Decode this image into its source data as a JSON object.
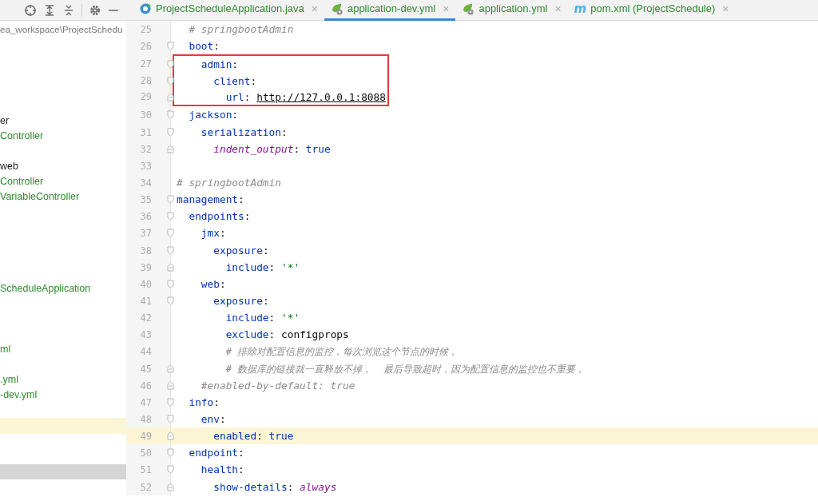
{
  "tabs": [
    {
      "label": "ProjectScheduleApplication.java",
      "kind": "java",
      "close": "×",
      "selected": false
    },
    {
      "label": "application-dev.yml",
      "kind": "spring",
      "close": "×",
      "selected": true
    },
    {
      "label": "application.yml",
      "kind": "spring",
      "close": "×",
      "selected": false
    },
    {
      "label": "pom.xml (ProjectSchedule)",
      "kind": "maven",
      "glyph": "m",
      "close": "×",
      "selected": false
    }
  ],
  "tree": {
    "rows": [
      {
        "kind": "path",
        "text": "ea_workspace\\ProjectSchedu",
        "color": "#787878",
        "selected": false,
        "highlighted": false
      },
      {
        "kind": "blank",
        "selected": false,
        "highlighted": false
      },
      {
        "kind": "blank",
        "selected": false,
        "highlighted": false
      },
      {
        "kind": "blank",
        "selected": false,
        "highlighted": false
      },
      {
        "kind": "blank",
        "selected": false,
        "highlighted": false
      },
      {
        "kind": "blank",
        "selected": false,
        "highlighted": false
      },
      {
        "kind": "node",
        "text": "er",
        "color": "#1f1f1f",
        "selected": false,
        "highlighted": false
      },
      {
        "kind": "node",
        "text": "Controller",
        "color": "#2e8a2e",
        "selected": false,
        "highlighted": false
      },
      {
        "kind": "blank",
        "selected": false,
        "highlighted": false
      },
      {
        "kind": "node",
        "text": "web",
        "color": "#1f1f1f",
        "selected": false,
        "highlighted": false
      },
      {
        "kind": "node",
        "text": "Controller",
        "color": "#2e8a2e",
        "selected": false,
        "highlighted": false
      },
      {
        "kind": "node",
        "text": "VariableController",
        "color": "#2e8a2e",
        "selected": false,
        "highlighted": false
      },
      {
        "kind": "blank",
        "selected": false,
        "highlighted": false
      },
      {
        "kind": "blank",
        "selected": false,
        "highlighted": false
      },
      {
        "kind": "blank",
        "selected": false,
        "highlighted": false
      },
      {
        "kind": "blank",
        "selected": false,
        "highlighted": false
      },
      {
        "kind": "blank",
        "selected": false,
        "highlighted": false
      },
      {
        "kind": "node",
        "text": "ScheduleApplication",
        "color": "#2e8a2e",
        "selected": false,
        "highlighted": false
      },
      {
        "kind": "blank",
        "selected": false,
        "highlighted": false
      },
      {
        "kind": "blank",
        "selected": false,
        "highlighted": false
      },
      {
        "kind": "blank",
        "selected": false,
        "highlighted": false
      },
      {
        "kind": "node",
        "text": "ml",
        "color": "#2e8a2e",
        "selected": false,
        "highlighted": false
      },
      {
        "kind": "blank",
        "selected": false,
        "highlighted": false
      },
      {
        "kind": "node",
        "text": ".yml",
        "color": "#2e8a2e",
        "selected": false,
        "highlighted": false
      },
      {
        "kind": "node",
        "text": "-dev.yml",
        "color": "#2e8a2e",
        "selected": false,
        "highlighted": false
      },
      {
        "kind": "blank",
        "selected": false,
        "highlighted": false
      },
      {
        "kind": "blank",
        "selected": false,
        "highlighted": true
      },
      {
        "kind": "blank",
        "selected": false,
        "highlighted": false
      },
      {
        "kind": "blank",
        "selected": false,
        "highlighted": false
      },
      {
        "kind": "blank",
        "selected": true,
        "highlighted": false
      }
    ]
  },
  "editor": {
    "lines": [
      {
        "number": "25",
        "kind": "plain",
        "current": false,
        "boxed": false,
        "tokens": [
          {
            "kind": "comment",
            "text": "  # springbootAdmin"
          }
        ]
      },
      {
        "number": "26",
        "kind": "fold-start",
        "current": false,
        "boxed": false,
        "tokens": [
          {
            "kind": "key",
            "text": "  boot"
          },
          {
            "kind": "punct",
            "text": ":"
          }
        ]
      },
      {
        "number": "27",
        "kind": "fold-start",
        "current": false,
        "boxed": true,
        "tokens": [
          {
            "kind": "key",
            "text": "    admin"
          },
          {
            "kind": "punct",
            "text": ":"
          }
        ]
      },
      {
        "number": "28",
        "kind": "fold-start",
        "current": false,
        "boxed": true,
        "tokens": [
          {
            "kind": "key",
            "text": "      client"
          },
          {
            "kind": "punct",
            "text": ":"
          }
        ]
      },
      {
        "number": "29",
        "kind": "fold-end",
        "current": false,
        "boxed": true,
        "tokens": [
          {
            "kind": "key",
            "text": "        url"
          },
          {
            "kind": "punct",
            "text": ": "
          },
          {
            "kind": "link",
            "text": "http://127.0.0.1:8088"
          }
        ]
      },
      {
        "number": "30",
        "kind": "fold-start",
        "current": false,
        "boxed": false,
        "tokens": [
          {
            "kind": "key",
            "text": "  jackson"
          },
          {
            "kind": "punct",
            "text": ":"
          }
        ]
      },
      {
        "number": "31",
        "kind": "fold-start",
        "current": false,
        "boxed": false,
        "tokens": [
          {
            "kind": "key",
            "text": "    serialization"
          },
          {
            "kind": "punct",
            "text": ":"
          }
        ]
      },
      {
        "number": "32",
        "kind": "fold-end",
        "current": false,
        "boxed": false,
        "tokens": [
          {
            "kind": "special",
            "text": "      indent_output"
          },
          {
            "kind": "punct",
            "text": ": "
          },
          {
            "kind": "bool",
            "text": "true"
          }
        ]
      },
      {
        "number": "33",
        "kind": "plain",
        "current": false,
        "boxed": false
      },
      {
        "number": "34",
        "kind": "plain",
        "current": false,
        "boxed": false,
        "tokens": [
          {
            "kind": "comment",
            "text": "# springbootAdmin"
          }
        ]
      },
      {
        "number": "35",
        "kind": "fold-start",
        "current": false,
        "boxed": false,
        "tokens": [
          {
            "kind": "key",
            "text": "management"
          },
          {
            "kind": "punct",
            "text": ":"
          }
        ]
      },
      {
        "number": "36",
        "kind": "fold-start",
        "current": false,
        "boxed": false,
        "tokens": [
          {
            "kind": "key",
            "text": "  endpoints"
          },
          {
            "kind": "punct",
            "text": ":"
          }
        ]
      },
      {
        "number": "37",
        "kind": "fold-start",
        "current": false,
        "boxed": false,
        "tokens": [
          {
            "kind": "key",
            "text": "    jmx"
          },
          {
            "kind": "punct",
            "text": ":"
          }
        ]
      },
      {
        "number": "38",
        "kind": "fold-start",
        "current": false,
        "boxed": false,
        "tokens": [
          {
            "kind": "key",
            "text": "      exposure"
          },
          {
            "kind": "punct",
            "text": ":"
          }
        ]
      },
      {
        "number": "39",
        "kind": "fold-end",
        "current": false,
        "boxed": false,
        "tokens": [
          {
            "kind": "key",
            "text": "        include"
          },
          {
            "kind": "punct",
            "text": ": "
          },
          {
            "kind": "string",
            "text": "'*'"
          }
        ]
      },
      {
        "number": "40",
        "kind": "fold-start",
        "current": false,
        "boxed": false,
        "tokens": [
          {
            "kind": "key",
            "text": "    web"
          },
          {
            "kind": "punct",
            "text": ":"
          }
        ]
      },
      {
        "number": "41",
        "kind": "fold-start",
        "current": false,
        "boxed": false,
        "tokens": [
          {
            "kind": "key",
            "text": "      exposure"
          },
          {
            "kind": "punct",
            "text": ":"
          }
        ]
      },
      {
        "number": "42",
        "kind": "plain",
        "current": false,
        "boxed": false,
        "tokens": [
          {
            "kind": "key",
            "text": "        include"
          },
          {
            "kind": "punct",
            "text": ": "
          },
          {
            "kind": "string",
            "text": "'*'"
          }
        ]
      },
      {
        "number": "43",
        "kind": "plain",
        "current": false,
        "boxed": false,
        "tokens": [
          {
            "kind": "key",
            "text": "        exclude"
          },
          {
            "kind": "punct",
            "text": ": "
          },
          {
            "kind": "plain",
            "text": "configprops"
          }
        ]
      },
      {
        "number": "44",
        "kind": "plain",
        "current": false,
        "boxed": false,
        "tokens": [
          {
            "kind": "comment",
            "text": "        # 排除对配置信息的监控，每次浏览这个节点的时候，"
          }
        ]
      },
      {
        "number": "45",
        "kind": "fold-end",
        "current": false,
        "boxed": false,
        "tokens": [
          {
            "kind": "comment",
            "text": "        # 数据库的链接就一直释放不掉，  最后导致超时，因为配置信息的监控也不重要，"
          }
        ]
      },
      {
        "number": "46",
        "kind": "fold-end",
        "current": false,
        "boxed": false,
        "tokens": [
          {
            "kind": "comment",
            "text": "    #enabled-by-default: true"
          }
        ]
      },
      {
        "number": "47",
        "kind": "fold-start",
        "current": false,
        "boxed": false,
        "tokens": [
          {
            "kind": "key",
            "text": "  info"
          },
          {
            "kind": "punct",
            "text": ":"
          }
        ]
      },
      {
        "number": "48",
        "kind": "fold-start",
        "current": false,
        "boxed": false,
        "tokens": [
          {
            "kind": "key",
            "text": "    env"
          },
          {
            "kind": "punct",
            "text": ":"
          }
        ]
      },
      {
        "number": "49",
        "kind": "fold-end",
        "current": true,
        "boxed": false,
        "tokens": [
          {
            "kind": "key",
            "text": "      enabled"
          },
          {
            "kind": "punct",
            "text": ": "
          },
          {
            "kind": "bool",
            "text": "true"
          }
        ]
      },
      {
        "number": "50",
        "kind": "fold-start",
        "current": false,
        "boxed": false,
        "tokens": [
          {
            "kind": "key",
            "text": "  endpoint"
          },
          {
            "kind": "punct",
            "text": ":"
          }
        ]
      },
      {
        "number": "51",
        "kind": "fold-start",
        "current": false,
        "boxed": false,
        "tokens": [
          {
            "kind": "key",
            "text": "    health"
          },
          {
            "kind": "punct",
            "text": ":"
          }
        ]
      },
      {
        "number": "52",
        "kind": "fold-end",
        "current": false,
        "boxed": false,
        "tokens": [
          {
            "kind": "key",
            "text": "      show-details"
          },
          {
            "kind": "punct",
            "text": ": "
          },
          {
            "kind": "special",
            "text": "always"
          }
        ]
      }
    ]
  }
}
